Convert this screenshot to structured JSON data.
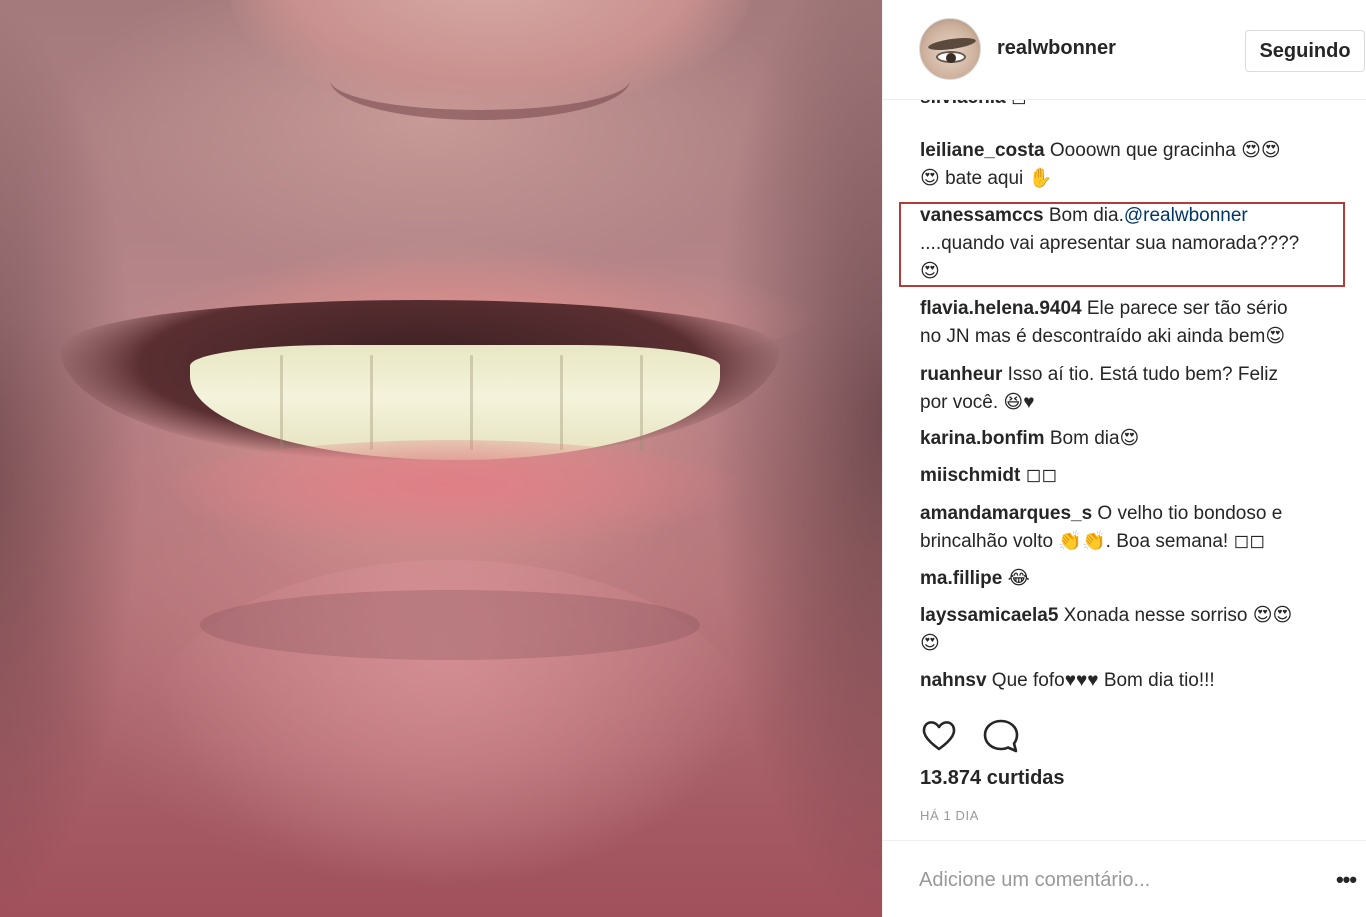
{
  "post": {
    "username": "realwbonner",
    "follow_label": "Seguindo",
    "likes": "13.874 curtidas",
    "timestamp": "HÁ 1 DIA",
    "comment_placeholder": "Adicione um comentário...",
    "more_label": "•••"
  },
  "comments": [
    {
      "author": "silviachia",
      "text": " ◻"
    },
    {
      "author": "leiliane_costa",
      "text": " Oooown que gracinha 😍😍",
      "text2": "😍 bate aqui ✋"
    },
    {
      "author": "vanessamccs",
      "text": " Bom dia.",
      "mention": "@realwbonner",
      "text2": "....quando vai apresentar sua namorada????",
      "text3": "😍"
    },
    {
      "author": "flavia.helena.9404",
      "text": " Ele parece ser tão sério",
      "text2": "no JN mas é descontraído aki ainda bem😍"
    },
    {
      "author": "ruanheur",
      "text": " Isso aí tio. Está tudo bem? Feliz",
      "text2": "por você. 😆♥"
    },
    {
      "author": "karina.bonfim",
      "text": " Bom dia😍"
    },
    {
      "author": "miischmidt",
      "text": " ◻◻"
    },
    {
      "author": "amandamarques_s",
      "text": " O velho tio bondoso e",
      "text2": "brincalhão volto 👏👏. Boa semana! ◻◻"
    },
    {
      "author": "ma.fillipe",
      "text": " 😂"
    },
    {
      "author": "layssamicaela5",
      "text": " Xonada nesse sorriso 😍😍",
      "text2": "😍"
    },
    {
      "author": "nahnsv",
      "text": " Que fofo♥♥♥ Bom dia tio!!!"
    }
  ],
  "icons": {
    "like": "heart-outline-icon",
    "comment": "speech-bubble-icon",
    "more": "ellipsis-icon"
  },
  "colors": {
    "highlight_box": "#b23b3b",
    "mention": "#003569"
  }
}
